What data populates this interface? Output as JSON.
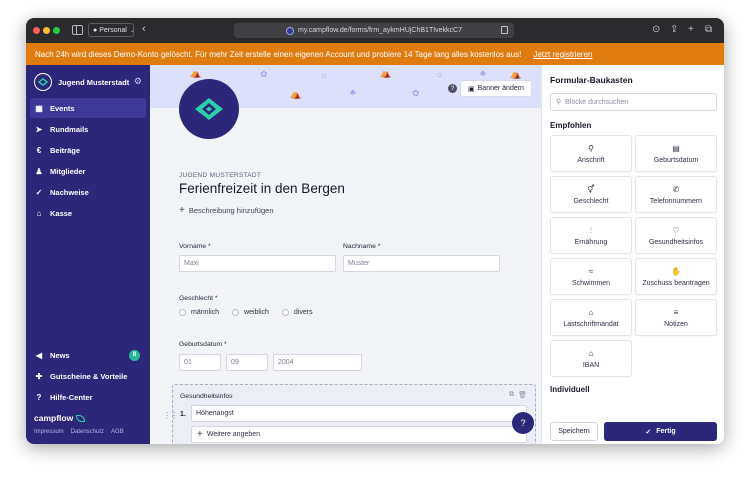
{
  "browser": {
    "profile": "Personal",
    "url": "my.campflow.de/forms/frm_aykmHUjChB1TIvekkcC7"
  },
  "demo_banner": {
    "text": "Nach 24h wird dieses Demo-Konto gelöscht.  Für mehr Zeit erstelle einen eigenen Account und probiere 14 Tage lang alles kostenlos aus!",
    "link": "Jetzt registrieren"
  },
  "sidebar": {
    "org_name": "Jugend Musterstadt",
    "items": [
      {
        "label": "Events",
        "icon": "calendar-icon"
      },
      {
        "label": "Rundmails",
        "icon": "send-icon"
      },
      {
        "label": "Beiträge",
        "icon": "euro-icon"
      },
      {
        "label": "Mitglieder",
        "icon": "users-icon"
      },
      {
        "label": "Nachweise",
        "icon": "check-icon"
      },
      {
        "label": "Kasse",
        "icon": "bank-icon"
      }
    ],
    "bottom_items": [
      {
        "label": "News",
        "badge": "8"
      },
      {
        "label": "Gutscheine & Vorteile"
      },
      {
        "label": "Hilfe-Center"
      }
    ],
    "brand": "campflow",
    "footer_links": [
      "Impressum",
      "Datenschutz",
      "AGB"
    ]
  },
  "main": {
    "banner_button": "Banner ändern",
    "org_caption": "JUGEND MUSTERSTADT",
    "title": "Ferienfreizeit in den Bergen",
    "add_description": "Beschreibung hinzufügen",
    "fields": {
      "vorname_label": "Vorname *",
      "vorname_placeholder": "Maxi",
      "nachname_label": "Nachname *",
      "nachname_placeholder": "Muster",
      "geschlecht_label": "Geschlecht *",
      "geschlecht_options": [
        "männlich",
        "weiblich",
        "divers"
      ],
      "geburtsdatum_label": "Geburtsdatum *",
      "day": "01",
      "month": "09",
      "year": "2004"
    },
    "health_block": {
      "title": "Gesundheitsinfos",
      "option_number": "1.",
      "option_value": "Höhenangst",
      "add_option": "Weitere angeben"
    }
  },
  "panel": {
    "title": "Formular-Baukasten",
    "search_placeholder": "Blöcke durchsuchen",
    "section_recommended": "Empfohlen",
    "tiles": [
      {
        "label": "Anschrift",
        "icon": "location-pin-icon"
      },
      {
        "label": "Geburtsdatum",
        "icon": "cake-icon"
      },
      {
        "label": "Geschlecht",
        "icon": "gender-icon"
      },
      {
        "label": "Telefonnummern",
        "icon": "phone-icon"
      },
      {
        "label": "Ernährung",
        "icon": "cutlery-icon"
      },
      {
        "label": "Gesundheitsinfos",
        "icon": "chat-heart-icon"
      },
      {
        "label": "Schwimmen",
        "icon": "swim-icon"
      },
      {
        "label": "Zuschuss beantragen",
        "icon": "hand-coin-icon"
      },
      {
        "label": "Lastschriftmandat",
        "icon": "bank-icon"
      },
      {
        "label": "Notizen",
        "icon": "notes-icon"
      },
      {
        "label": "IBAN",
        "icon": "bank-icon"
      }
    ],
    "section_individual": "Individuell",
    "save_button": "Speichern",
    "done_button": "Fertig"
  }
}
